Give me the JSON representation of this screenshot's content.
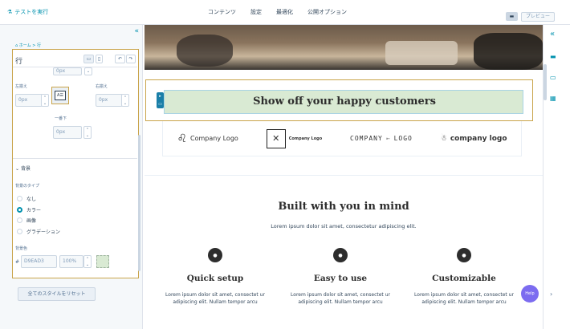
{
  "topbar": {
    "test_label": "テストを実行",
    "tabs": [
      "コンテンツ",
      "設定",
      "最適化",
      "公開オプション"
    ],
    "preview_label": "プレビュー"
  },
  "sidebar": {
    "breadcrumb": "ホーム > 行",
    "panel_title": "行",
    "top_value": "0px",
    "left_label": "左揃え",
    "right_label": "右揃え",
    "left_value": "0px",
    "right_value": "0px",
    "bottom_label": "一番下",
    "bottom_value": "0px",
    "background_section": "背景",
    "background_type_label": "背景のタイプ",
    "background_types": [
      "なし",
      "カラー",
      "画像",
      "グラデーション"
    ],
    "background_type_selected": "カラー",
    "bgcolor_label": "背景色",
    "bgcolor_hex": "D9EAD3",
    "bgcolor_opacity": "100%",
    "reset_label": "全てのスタイルをリセット",
    "swatch_color": "#d9ead3"
  },
  "canvas": {
    "band_title": "Show off your happy customers",
    "logos": [
      "Company Logo",
      "Company Logo",
      "COMPANY",
      "LOGO",
      "company logo"
    ],
    "section_title": "Built with you in mind",
    "section_subtitle": "Lorem ipsum dolor sit amet, consectetur adipiscing elit.",
    "features": [
      {
        "title": "Quick setup",
        "text": "Lorem ipsum dolor sit amet, consectet ur adipiscing elit. Nullam tempor arcu"
      },
      {
        "title": "Easy to use",
        "text": "Lorem ipsum dolor sit amet, consectet ur adipiscing elit. Nullam tempor arcu"
      },
      {
        "title": "Customizable",
        "text": "Lorem ipsum dolor sit amet, consectet ur adipiscing elit. Nullam tempor arcu"
      }
    ],
    "help_label": "Help"
  },
  "colors": {
    "accent": "#0091ae",
    "selection_outline": "#c9a44a",
    "band_fill": "#d9ead3",
    "help_button": "#7c6cf0"
  }
}
